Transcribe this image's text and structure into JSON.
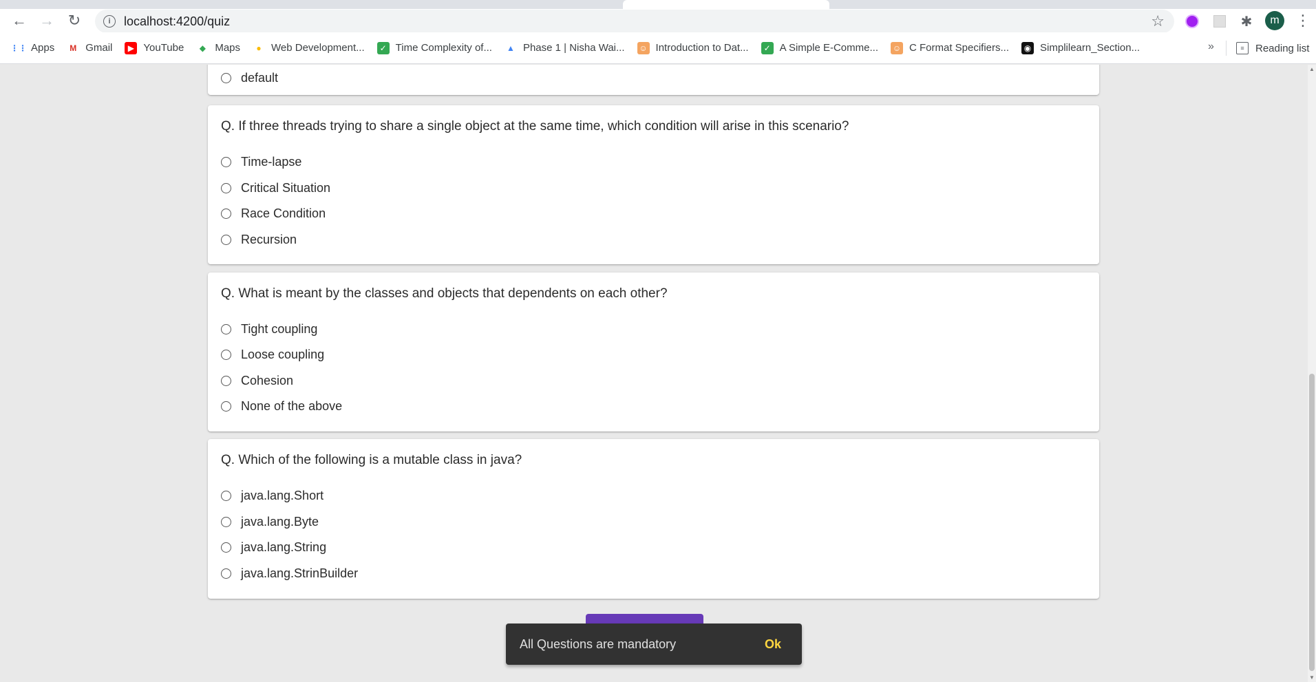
{
  "browser": {
    "url": "localhost:4200/quiz",
    "avatar_letter": "m",
    "bookmarks": [
      {
        "label": "Apps",
        "icon": "apps-grid-icon"
      },
      {
        "label": "Gmail",
        "icon": "gmail-icon"
      },
      {
        "label": "YouTube",
        "icon": "youtube-icon"
      },
      {
        "label": "Maps",
        "icon": "maps-icon"
      },
      {
        "label": "Web Development...",
        "icon": "web-dev-icon"
      },
      {
        "label": "Time Complexity of...",
        "icon": "leaf-icon"
      },
      {
        "label": "Phase 1 | Nisha Wai...",
        "icon": "drive-icon"
      },
      {
        "label": "Introduction to Dat...",
        "icon": "profile-icon"
      },
      {
        "label": "A Simple E-Comme...",
        "icon": "leaf-icon"
      },
      {
        "label": "C Format Specifiers...",
        "icon": "profile-icon"
      },
      {
        "label": "Simplilearn_Section...",
        "icon": "github-icon"
      }
    ],
    "more_label": "»",
    "reading_list_label": "Reading list"
  },
  "quiz": {
    "partial_option": "default",
    "questions": [
      {
        "text": "Q. If three threads trying to share a single object at the same time, which condition will arise in this scenario?",
        "options": [
          "Time-lapse",
          "Critical Situation",
          "Race Condition",
          "Recursion"
        ]
      },
      {
        "text": "Q. What is meant by the classes and objects that dependents on each other?",
        "options": [
          "Tight coupling",
          "Loose coupling",
          "Cohesion",
          "None of the above"
        ]
      },
      {
        "text": "Q. Which of the following is a mutable class in java?",
        "options": [
          "java.lang.Short",
          "java.lang.Byte",
          "java.lang.String",
          "java.lang.StrinBuilder"
        ]
      }
    ]
  },
  "snackbar": {
    "message": "All Questions are mandatory",
    "action": "Ok"
  },
  "colors": {
    "accent": "#673ab7",
    "snackbar_bg": "#323232",
    "snackbar_action": "#ffd740"
  }
}
